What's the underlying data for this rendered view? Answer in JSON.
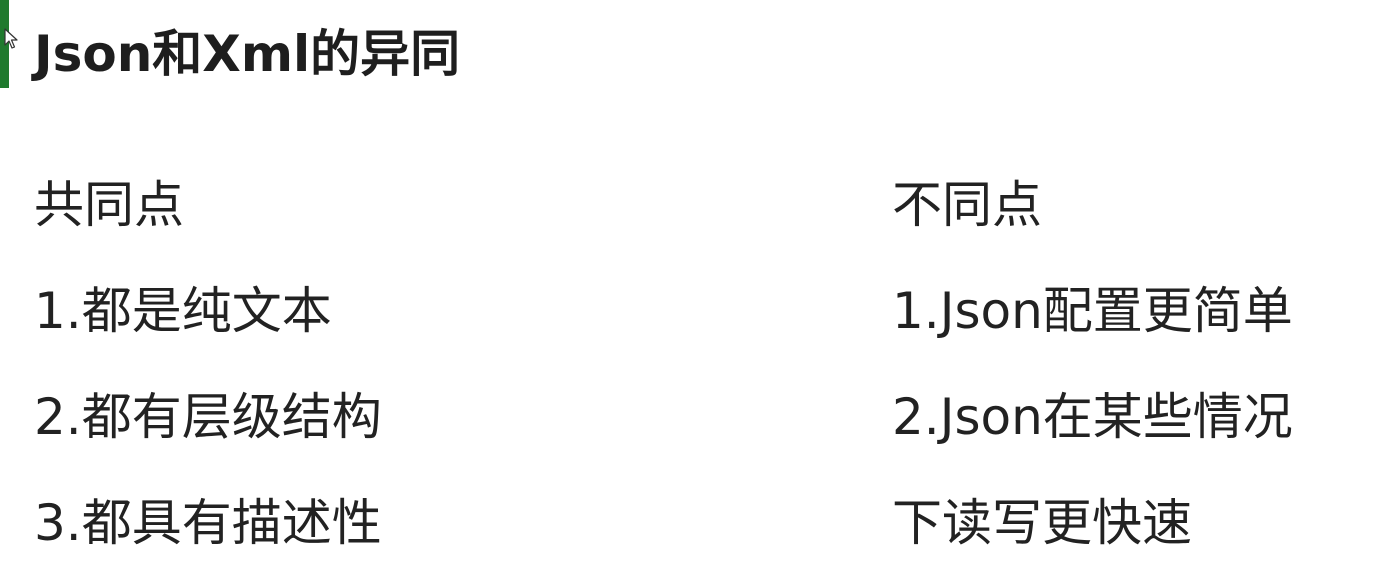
{
  "slide": {
    "accent_color": "#1f7a2e",
    "title": "Json和Xml的异同",
    "similarities": {
      "heading": "共同点",
      "items": [
        "1.都是纯文本",
        "2.都有层级结构",
        "3.都具有描述性"
      ]
    },
    "differences": {
      "heading": "不同点",
      "lines": [
        "1.Json配置更简单",
        "2.Json在某些情况",
        "下读写更快速"
      ]
    }
  }
}
